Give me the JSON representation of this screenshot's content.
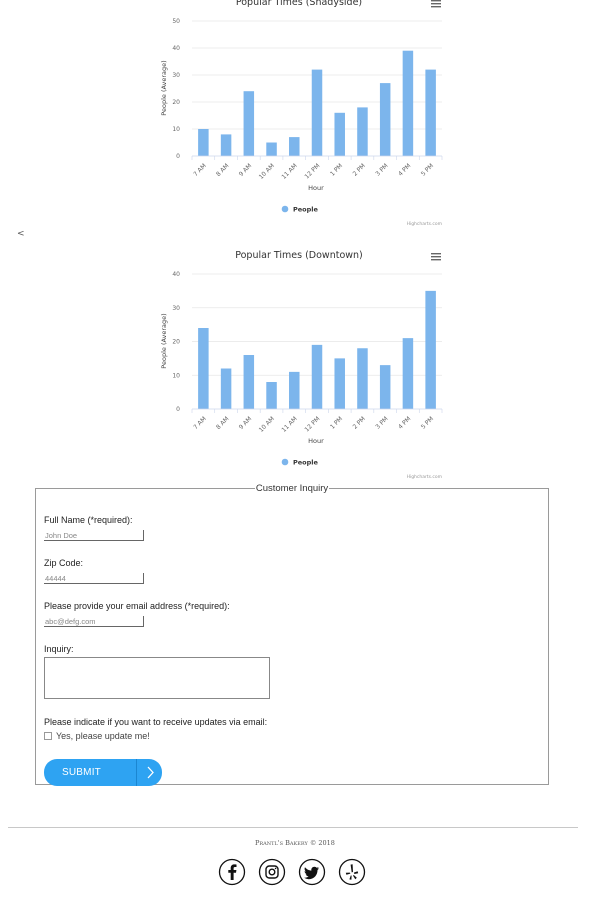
{
  "chart_data": [
    {
      "type": "bar",
      "title": "Popular Times (Shadyside)",
      "categories": [
        "7 AM",
        "8 AM",
        "9 AM",
        "10 AM",
        "11 AM",
        "12 PM",
        "1 PM",
        "2 PM",
        "3 PM",
        "4 PM",
        "5 PM"
      ],
      "series": [
        {
          "name": "People",
          "values": [
            10,
            8,
            24,
            5,
            7,
            32,
            16,
            18,
            27,
            39,
            32
          ]
        }
      ],
      "xlabel": "Hour",
      "ylabel": "People (Average)",
      "ylim": [
        0,
        50
      ],
      "yticks": [
        0,
        10,
        20,
        30,
        40,
        50
      ],
      "grid": true,
      "legend_position": "bottom",
      "color": "#7cb5ec",
      "credits": "Highcharts.com"
    },
    {
      "type": "bar",
      "title": "Popular Times (Downtown)",
      "categories": [
        "7 AM",
        "8 AM",
        "9 AM",
        "10 AM",
        "11 AM",
        "12 PM",
        "1 PM",
        "2 PM",
        "3 PM",
        "4 PM",
        "5 PM"
      ],
      "series": [
        {
          "name": "People",
          "values": [
            24,
            12,
            16,
            8,
            11,
            19,
            15,
            18,
            13,
            21,
            35
          ]
        }
      ],
      "xlabel": "Hour",
      "ylabel": "People (Average)",
      "ylim": [
        0,
        40
      ],
      "yticks": [
        0,
        10,
        20,
        30,
        40
      ],
      "grid": true,
      "legend_position": "bottom",
      "color": "#7cb5ec",
      "credits": "Highcharts.com"
    }
  ],
  "nav": {
    "back": "<"
  },
  "form": {
    "legend": "Customer Inquiry",
    "fullname_label": "Full Name (*required):",
    "fullname_placeholder": "John Doe",
    "zip_label": "Zip Code:",
    "zip_placeholder": "44444",
    "email_label": "Please provide your email address (*required):",
    "email_placeholder": "abc@defg.com",
    "inquiry_label": "Inquiry:",
    "updates_label": "Please indicate if you want to receive updates via email:",
    "updates_checkbox_label": "Yes, please update me!",
    "submit_label": "SUBMIT"
  },
  "footer": {
    "copyright": "Prantl's Bakery © 2018",
    "socials": [
      "facebook-icon",
      "instagram-icon",
      "twitter-icon",
      "yelp-icon"
    ]
  },
  "colors": {
    "bar": "#7cb5ec",
    "button": "#2ea3f2"
  }
}
